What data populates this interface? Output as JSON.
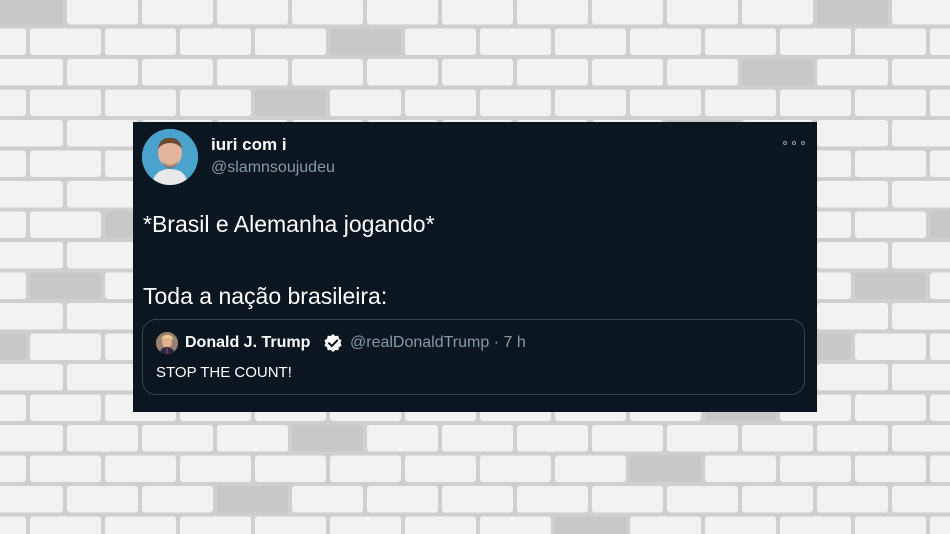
{
  "background": {
    "type": "brick-wall",
    "brick_color": "#f2f2f2",
    "mortar_color": "#cfcfcf",
    "dark_brick_color": "#c8c8c8"
  },
  "tweet": {
    "background_color": "#0b1621",
    "author": {
      "display_name": "iuri com i",
      "handle": "@slamnsoujudeu"
    },
    "more_icon": "more-horizontal-icon",
    "text_lines": [
      "*Brasil e Alemanha jogando*",
      "Toda a nação brasileira:"
    ],
    "quoted_tweet": {
      "display_name": "Donald J. Trump",
      "verified": true,
      "verified_color": "#ffffff",
      "meta": "@realDonaldTrump · 7 h",
      "text": "STOP THE COUNT!"
    }
  }
}
